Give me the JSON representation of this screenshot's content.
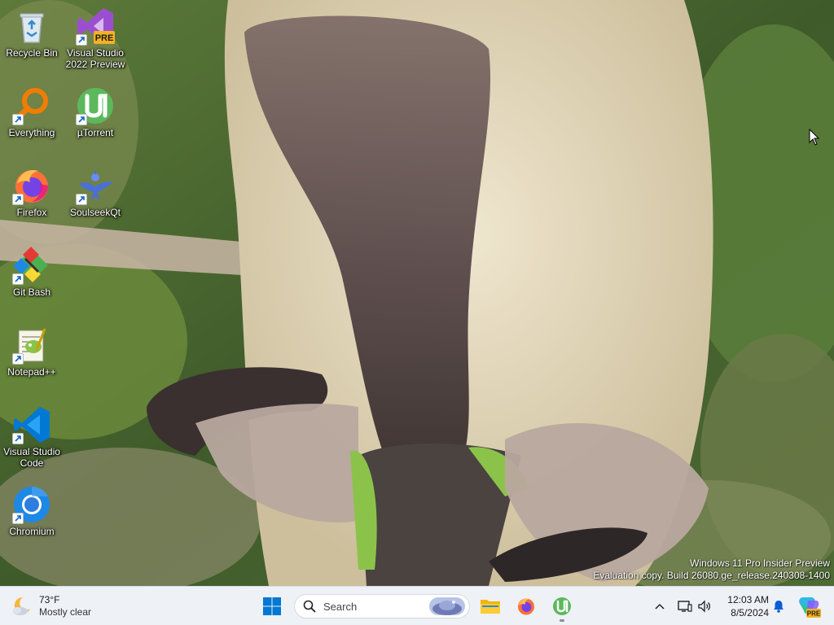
{
  "desktop": {
    "icons": [
      {
        "label": "Recycle Bin",
        "icon": "recycle-bin-icon",
        "shortcut": false
      },
      {
        "label": "Visual Studio\n2022 Preview",
        "icon": "visual-studio-preview-icon",
        "shortcut": true,
        "badge": "PRE"
      },
      {
        "label": "Everything",
        "icon": "everything-search-icon",
        "shortcut": true
      },
      {
        "label": "µTorrent",
        "icon": "utorrent-icon",
        "shortcut": true
      },
      {
        "label": "Firefox",
        "icon": "firefox-icon",
        "shortcut": true
      },
      {
        "label": "SoulseekQt",
        "icon": "soulseekqt-icon",
        "shortcut": true
      },
      {
        "label": "Git Bash",
        "icon": "git-bash-icon",
        "shortcut": true
      },
      {
        "label": "Notepad++",
        "icon": "notepadpp-icon",
        "shortcut": true
      },
      {
        "label": "Visual Studio\nCode",
        "icon": "vscode-icon",
        "shortcut": true
      },
      {
        "label": "Chromium",
        "icon": "chromium-icon",
        "shortcut": true
      }
    ]
  },
  "watermark": {
    "line1": "Windows 11 Pro Insider Preview",
    "line2": "Evaluation copy. Build 26080.ge_release.240308-1400"
  },
  "taskbar": {
    "weather": {
      "temp": "73°F",
      "condition": "Mostly clear",
      "icon": "moon-cloud-icon"
    },
    "start_icon": "windows-start-icon",
    "search": {
      "placeholder": "Search",
      "icon": "search-icon"
    },
    "pinned": [
      {
        "name": "file-explorer-icon",
        "running": false
      },
      {
        "name": "firefox-icon",
        "running": false
      },
      {
        "name": "utorrent-icon",
        "running": true
      }
    ],
    "tray": {
      "chevron_icon": "chevron-up-icon",
      "network_icon": "network-icon",
      "volume_icon": "volume-icon",
      "time": "12:03 AM",
      "date": "8/5/2024",
      "bell_icon": "notification-bell-icon",
      "copilot_icon": "copilot-pre-icon",
      "copilot_badge": "PRE"
    }
  },
  "colors": {
    "taskbar_bg": "#eef1f6",
    "windows_blue": "#0078d4",
    "utorrent_green": "#5cb85c",
    "firefox_orange": "#ff7139"
  }
}
